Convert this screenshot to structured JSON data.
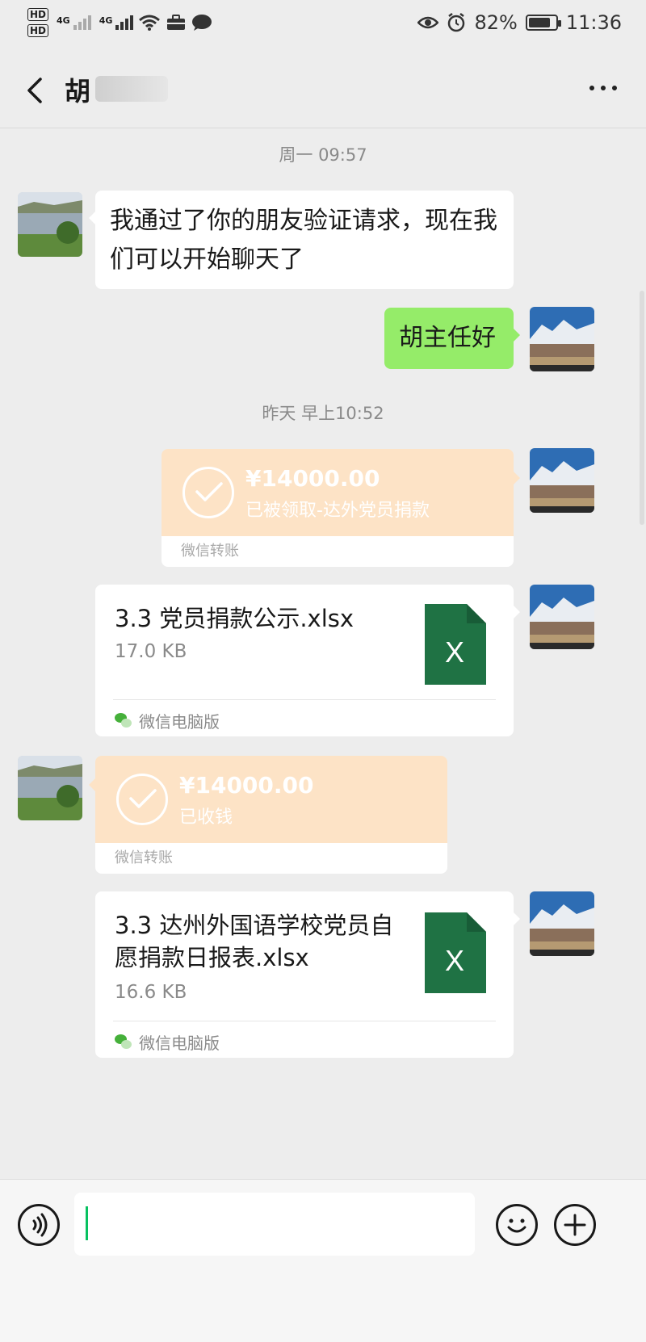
{
  "status_bar": {
    "hd1": "HD",
    "hd2": "HD",
    "net1": "4G",
    "net2": "4G",
    "battery_percent": "82%",
    "battery_level": 0.82,
    "time": "11:36",
    "icons": [
      "eye-icon",
      "alarm-icon",
      "battery-icon",
      "wifi-icon",
      "briefcase-icon",
      "message-icon"
    ]
  },
  "header": {
    "title": "胡",
    "more_label": "..."
  },
  "messages": {
    "time1": "周一 09:57",
    "m1_text": "我通过了你的朋友验证请求，现在我们可以开始聊天了",
    "m2_text": "胡主任好",
    "time2": "昨天 早上10:52",
    "t1_amount": "¥14000.00",
    "t1_status": "已被领取-达外党员捐款",
    "t1_label": "微信转账",
    "f1_name": "3.3 党员捐款公示.xlsx",
    "f1_size": "17.0 KB",
    "f1_source": "微信电脑版",
    "t2_amount": "¥14000.00",
    "t2_status": "已收钱",
    "t2_label": "微信转账",
    "f2_name": "3.3 达州外国语学校党员自愿捐款日报表.xlsx",
    "f2_size": "16.6 KB",
    "f2_source": "微信电脑版",
    "excel_letter": "X"
  },
  "colors": {
    "green_bubble": "#95ec69",
    "transfer_bg": "#fde3c6",
    "excel_green": "#1f7244",
    "wechat_green": "#07c160"
  }
}
